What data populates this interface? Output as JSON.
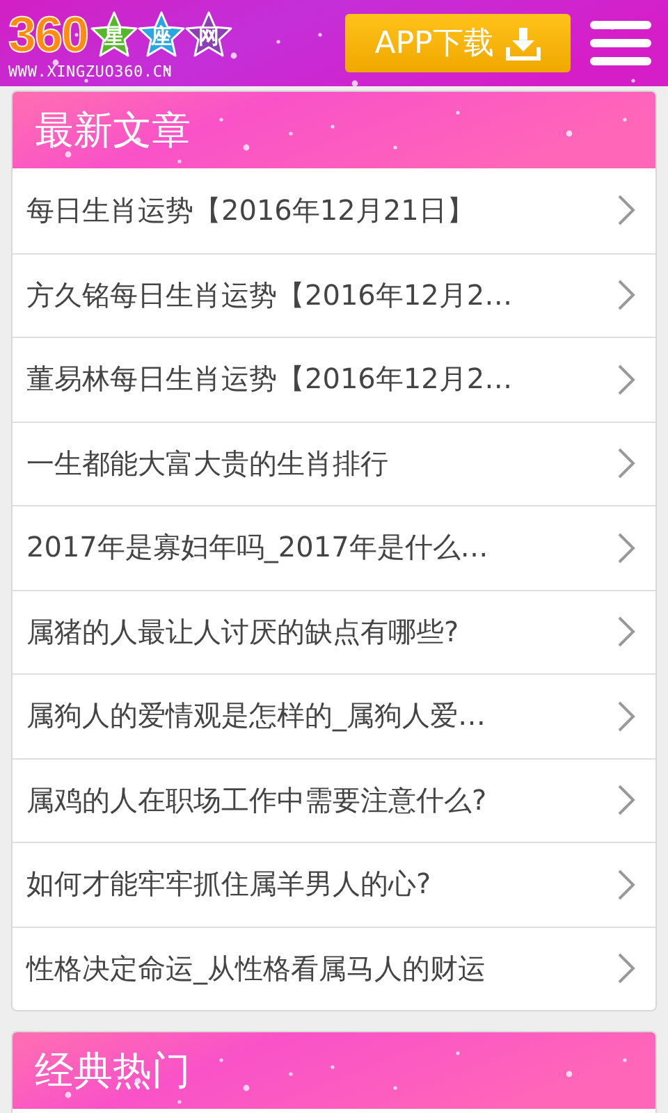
{
  "header": {
    "logo": {
      "number": "360",
      "stars": [
        {
          "char": "星",
          "color": "#55b82a"
        },
        {
          "char": "座",
          "color": "#2aa7e0"
        },
        {
          "char": "网",
          "color": "#8a3fb5"
        }
      ],
      "url": "WWW.XINGZUO360.CN"
    },
    "app_button": "APP下载"
  },
  "sections": [
    {
      "title": "最新文章",
      "articles": [
        {
          "title": "每日生肖运势【2016年12月21日】"
        },
        {
          "title": "方久铭每日生肖运势【2016年12月2…"
        },
        {
          "title": "董易林每日生肖运势【2016年12月2…"
        },
        {
          "title": "一生都能大富大贵的生肖排行"
        },
        {
          "title": "2017年是寡妇年吗_2017年是什么…"
        },
        {
          "title": "属猪的人最让人讨厌的缺点有哪些?"
        },
        {
          "title": "属狗人的爱情观是怎样的_属狗人爱…"
        },
        {
          "title": "属鸡的人在职场工作中需要注意什么?"
        },
        {
          "title": "如何才能牢牢抓住属羊男人的心?"
        },
        {
          "title": "性格决定命运_从性格看属马人的财运"
        }
      ]
    },
    {
      "title": "经典热门"
    }
  ]
}
